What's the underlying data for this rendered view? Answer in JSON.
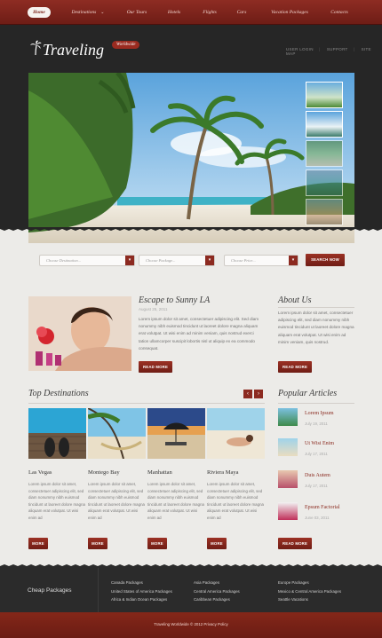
{
  "nav": {
    "items": [
      "Home",
      "Destinations",
      "Our Tours",
      "Hotels",
      "Flights",
      "Cars",
      "Vacation Packages",
      "Contacts"
    ]
  },
  "brand": {
    "name": "Traveling",
    "badge": "Worldwide"
  },
  "user_links": [
    "USER LOGIN",
    "SUPPORT",
    "SITE MAP"
  ],
  "search": {
    "destination_placeholder": "Choose Destination...",
    "package_placeholder": "Choose Package...",
    "price_placeholder": "Choose Price...",
    "button": "SEARCH NOW"
  },
  "featured": {
    "title": "Escape to Sunny LA",
    "date": "August 25, 2011",
    "text": "Lorem ipsum dolor sit amet, consectetuer adipiscing elit. Sed diam nonummy nibh euismod tincidunt ut laoreet dolore magna aliquam erat volutpat. Ut wisi enim ad minim veniam, quis nostrud exerci tation ullamcorper suscipit lobortis nisl ut aliquip ex ea commodo consequat.",
    "button": "READ MORE"
  },
  "about": {
    "title": "About Us",
    "text": "Lorem ipsum dolor sit amet, consectetuer adipiscing elit, sed diam nonummy nibh euismod tincidunt ut laoreet dolore magna aliquam erat volutpat. Ut wisi enim ad minim veniam, quis nostrud.",
    "button": "READ MORE"
  },
  "top_destinations": {
    "title": "Top Destinations",
    "items": [
      {
        "name": "Las Vegas",
        "text": "Lorem ipsum dolor sit amet, consectetuer adipiscing elit, sed diam nonummy nibh euismod tincidunt ut laoreet dolore magna aliquam erat volutpat. Ut wisi enim ad",
        "button": "MORE"
      },
      {
        "name": "Montego Bay",
        "text": "Lorem ipsum dolor sit amet, consectetuer adipiscing elit, sed diam nonummy nibh euismod tincidunt ut laoreet dolore magna aliquam erat volutpat. Ut wisi enim ad",
        "button": "MORE"
      },
      {
        "name": "Manhattan",
        "text": "Lorem ipsum dolor sit amet, consectetuer adipiscing elit, sed diam nonummy nibh euismod tincidunt ut laoreet dolore magna aliquam erat volutpat. Ut wisi enim ad",
        "button": "MORE"
      },
      {
        "name": "Riviera Maya",
        "text": "Lorem ipsum dolor sit amet, consectetuer adipiscing elit, sed diam nonummy nibh euismod tincidunt ut laoreet dolore magna aliquam erat volutpat. Ut wisi enim ad",
        "button": "MORE"
      }
    ]
  },
  "popular": {
    "title": "Popular Articles",
    "items": [
      {
        "title": "Lorem Ipsum",
        "date": "July 19, 2011"
      },
      {
        "title": "Ut Wisi Enim",
        "date": "July 17, 2011"
      },
      {
        "title": "Duis Autem",
        "date": "July 17, 2011"
      },
      {
        "title": "Epsum Factorial",
        "date": "June 03, 2011"
      }
    ],
    "button": "READ MORE"
  },
  "footer": {
    "label": "Cheap Packages",
    "col1": [
      "Canada Packages",
      "United States of America Packages",
      "Africa & Indian Ocean Packages"
    ],
    "col2": [
      "Asia Packages",
      "Central America Packages",
      "Caribbean Packages"
    ],
    "col3": [
      "Europe Packages",
      "Mexico & Central America Packages",
      "Seattle Vacations"
    ],
    "copyright": "Traveling Worldwide © 2012 Privacy Policy"
  }
}
